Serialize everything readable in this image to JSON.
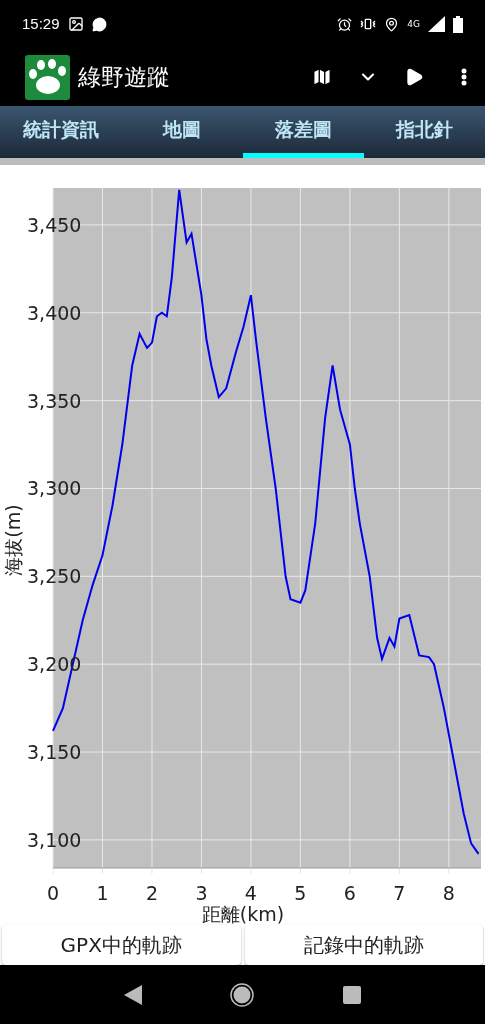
{
  "status_bar": {
    "time": "15:29",
    "network": "4G"
  },
  "app_bar": {
    "title": "綠野遊蹤"
  },
  "tabs": [
    {
      "label": "統計資訊",
      "selected": false
    },
    {
      "label": "地圖",
      "selected": false
    },
    {
      "label": "落差圖",
      "selected": true
    },
    {
      "label": "指北針",
      "selected": false
    }
  ],
  "chart": {
    "chart_data": {
      "type": "line",
      "xlabel": "距離(km)",
      "ylabel": "海拔(m)",
      "xlim": [
        0,
        8.65
      ],
      "ylim": [
        3084,
        3471
      ],
      "xticks": [
        0,
        1,
        2,
        3,
        4,
        5,
        6,
        7,
        8
      ],
      "yticks": [
        {
          "value": 3100,
          "label": "3,100"
        },
        {
          "value": 3150,
          "label": "3,150"
        },
        {
          "value": 3200,
          "label": "3,200"
        },
        {
          "value": 3250,
          "label": "3,250"
        },
        {
          "value": 3300,
          "label": "3,300"
        },
        {
          "value": 3350,
          "label": "3,350"
        },
        {
          "value": 3400,
          "label": "3,400"
        },
        {
          "value": 3450,
          "label": "3,450"
        }
      ],
      "x": [
        0,
        0.2,
        0.4,
        0.6,
        0.8,
        1.0,
        1.2,
        1.4,
        1.6,
        1.75,
        1.9,
        2.0,
        2.1,
        2.2,
        2.3,
        2.4,
        2.55,
        2.7,
        2.8,
        3.0,
        3.1,
        3.2,
        3.35,
        3.5,
        3.7,
        3.85,
        4.0,
        4.1,
        4.3,
        4.5,
        4.7,
        4.8,
        5.0,
        5.1,
        5.3,
        5.5,
        5.65,
        5.8,
        6.0,
        6.1,
        6.2,
        6.4,
        6.55,
        6.65,
        6.8,
        6.9,
        7.0,
        7.2,
        7.4,
        7.6,
        7.7,
        7.9,
        8.1,
        8.3,
        8.45,
        8.6
      ],
      "grid": true,
      "series": [
        {
          "color": "#0000ee",
          "values": [
            3162,
            3175,
            3200,
            3225,
            3245,
            3262,
            3290,
            3325,
            3370,
            3388,
            3380,
            3383,
            3398,
            3400,
            3398,
            3420,
            3470,
            3440,
            3445,
            3410,
            3385,
            3370,
            3352,
            3357,
            3378,
            3392,
            3410,
            3385,
            3340,
            3300,
            3250,
            3237,
            3235,
            3242,
            3280,
            3340,
            3370,
            3345,
            3325,
            3300,
            3280,
            3250,
            3215,
            3203,
            3215,
            3210,
            3226,
            3228,
            3205,
            3204,
            3200,
            3175,
            3145,
            3115,
            3098,
            3092
          ]
        }
      ]
    }
  },
  "buttons": [
    {
      "label": "GPX中的軌跡"
    },
    {
      "label": "記錄中的軌跡"
    }
  ]
}
